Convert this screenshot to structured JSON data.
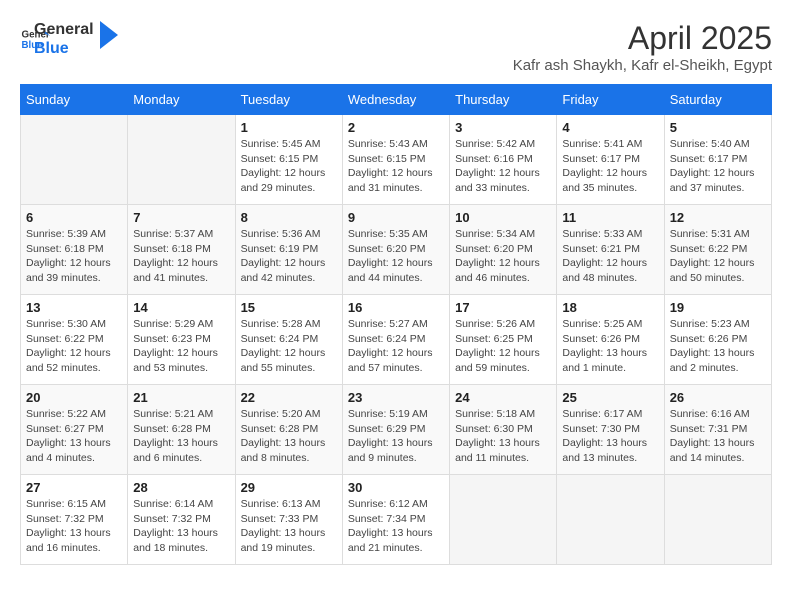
{
  "header": {
    "logo_line1": "General",
    "logo_line2": "Blue",
    "title": "April 2025",
    "subtitle": "Kafr ash Shaykh, Kafr el-Sheikh, Egypt"
  },
  "weekdays": [
    "Sunday",
    "Monday",
    "Tuesday",
    "Wednesday",
    "Thursday",
    "Friday",
    "Saturday"
  ],
  "weeks": [
    [
      {
        "day": "",
        "info": ""
      },
      {
        "day": "",
        "info": ""
      },
      {
        "day": "1",
        "info": "Sunrise: 5:45 AM\nSunset: 6:15 PM\nDaylight: 12 hours\nand 29 minutes."
      },
      {
        "day": "2",
        "info": "Sunrise: 5:43 AM\nSunset: 6:15 PM\nDaylight: 12 hours\nand 31 minutes."
      },
      {
        "day": "3",
        "info": "Sunrise: 5:42 AM\nSunset: 6:16 PM\nDaylight: 12 hours\nand 33 minutes."
      },
      {
        "day": "4",
        "info": "Sunrise: 5:41 AM\nSunset: 6:17 PM\nDaylight: 12 hours\nand 35 minutes."
      },
      {
        "day": "5",
        "info": "Sunrise: 5:40 AM\nSunset: 6:17 PM\nDaylight: 12 hours\nand 37 minutes."
      }
    ],
    [
      {
        "day": "6",
        "info": "Sunrise: 5:39 AM\nSunset: 6:18 PM\nDaylight: 12 hours\nand 39 minutes."
      },
      {
        "day": "7",
        "info": "Sunrise: 5:37 AM\nSunset: 6:18 PM\nDaylight: 12 hours\nand 41 minutes."
      },
      {
        "day": "8",
        "info": "Sunrise: 5:36 AM\nSunset: 6:19 PM\nDaylight: 12 hours\nand 42 minutes."
      },
      {
        "day": "9",
        "info": "Sunrise: 5:35 AM\nSunset: 6:20 PM\nDaylight: 12 hours\nand 44 minutes."
      },
      {
        "day": "10",
        "info": "Sunrise: 5:34 AM\nSunset: 6:20 PM\nDaylight: 12 hours\nand 46 minutes."
      },
      {
        "day": "11",
        "info": "Sunrise: 5:33 AM\nSunset: 6:21 PM\nDaylight: 12 hours\nand 48 minutes."
      },
      {
        "day": "12",
        "info": "Sunrise: 5:31 AM\nSunset: 6:22 PM\nDaylight: 12 hours\nand 50 minutes."
      }
    ],
    [
      {
        "day": "13",
        "info": "Sunrise: 5:30 AM\nSunset: 6:22 PM\nDaylight: 12 hours\nand 52 minutes."
      },
      {
        "day": "14",
        "info": "Sunrise: 5:29 AM\nSunset: 6:23 PM\nDaylight: 12 hours\nand 53 minutes."
      },
      {
        "day": "15",
        "info": "Sunrise: 5:28 AM\nSunset: 6:24 PM\nDaylight: 12 hours\nand 55 minutes."
      },
      {
        "day": "16",
        "info": "Sunrise: 5:27 AM\nSunset: 6:24 PM\nDaylight: 12 hours\nand 57 minutes."
      },
      {
        "day": "17",
        "info": "Sunrise: 5:26 AM\nSunset: 6:25 PM\nDaylight: 12 hours\nand 59 minutes."
      },
      {
        "day": "18",
        "info": "Sunrise: 5:25 AM\nSunset: 6:26 PM\nDaylight: 13 hours\nand 1 minute."
      },
      {
        "day": "19",
        "info": "Sunrise: 5:23 AM\nSunset: 6:26 PM\nDaylight: 13 hours\nand 2 minutes."
      }
    ],
    [
      {
        "day": "20",
        "info": "Sunrise: 5:22 AM\nSunset: 6:27 PM\nDaylight: 13 hours\nand 4 minutes."
      },
      {
        "day": "21",
        "info": "Sunrise: 5:21 AM\nSunset: 6:28 PM\nDaylight: 13 hours\nand 6 minutes."
      },
      {
        "day": "22",
        "info": "Sunrise: 5:20 AM\nSunset: 6:28 PM\nDaylight: 13 hours\nand 8 minutes."
      },
      {
        "day": "23",
        "info": "Sunrise: 5:19 AM\nSunset: 6:29 PM\nDaylight: 13 hours\nand 9 minutes."
      },
      {
        "day": "24",
        "info": "Sunrise: 5:18 AM\nSunset: 6:30 PM\nDaylight: 13 hours\nand 11 minutes."
      },
      {
        "day": "25",
        "info": "Sunrise: 6:17 AM\nSunset: 7:30 PM\nDaylight: 13 hours\nand 13 minutes."
      },
      {
        "day": "26",
        "info": "Sunrise: 6:16 AM\nSunset: 7:31 PM\nDaylight: 13 hours\nand 14 minutes."
      }
    ],
    [
      {
        "day": "27",
        "info": "Sunrise: 6:15 AM\nSunset: 7:32 PM\nDaylight: 13 hours\nand 16 minutes."
      },
      {
        "day": "28",
        "info": "Sunrise: 6:14 AM\nSunset: 7:32 PM\nDaylight: 13 hours\nand 18 minutes."
      },
      {
        "day": "29",
        "info": "Sunrise: 6:13 AM\nSunset: 7:33 PM\nDaylight: 13 hours\nand 19 minutes."
      },
      {
        "day": "30",
        "info": "Sunrise: 6:12 AM\nSunset: 7:34 PM\nDaylight: 13 hours\nand 21 minutes."
      },
      {
        "day": "",
        "info": ""
      },
      {
        "day": "",
        "info": ""
      },
      {
        "day": "",
        "info": ""
      }
    ]
  ]
}
